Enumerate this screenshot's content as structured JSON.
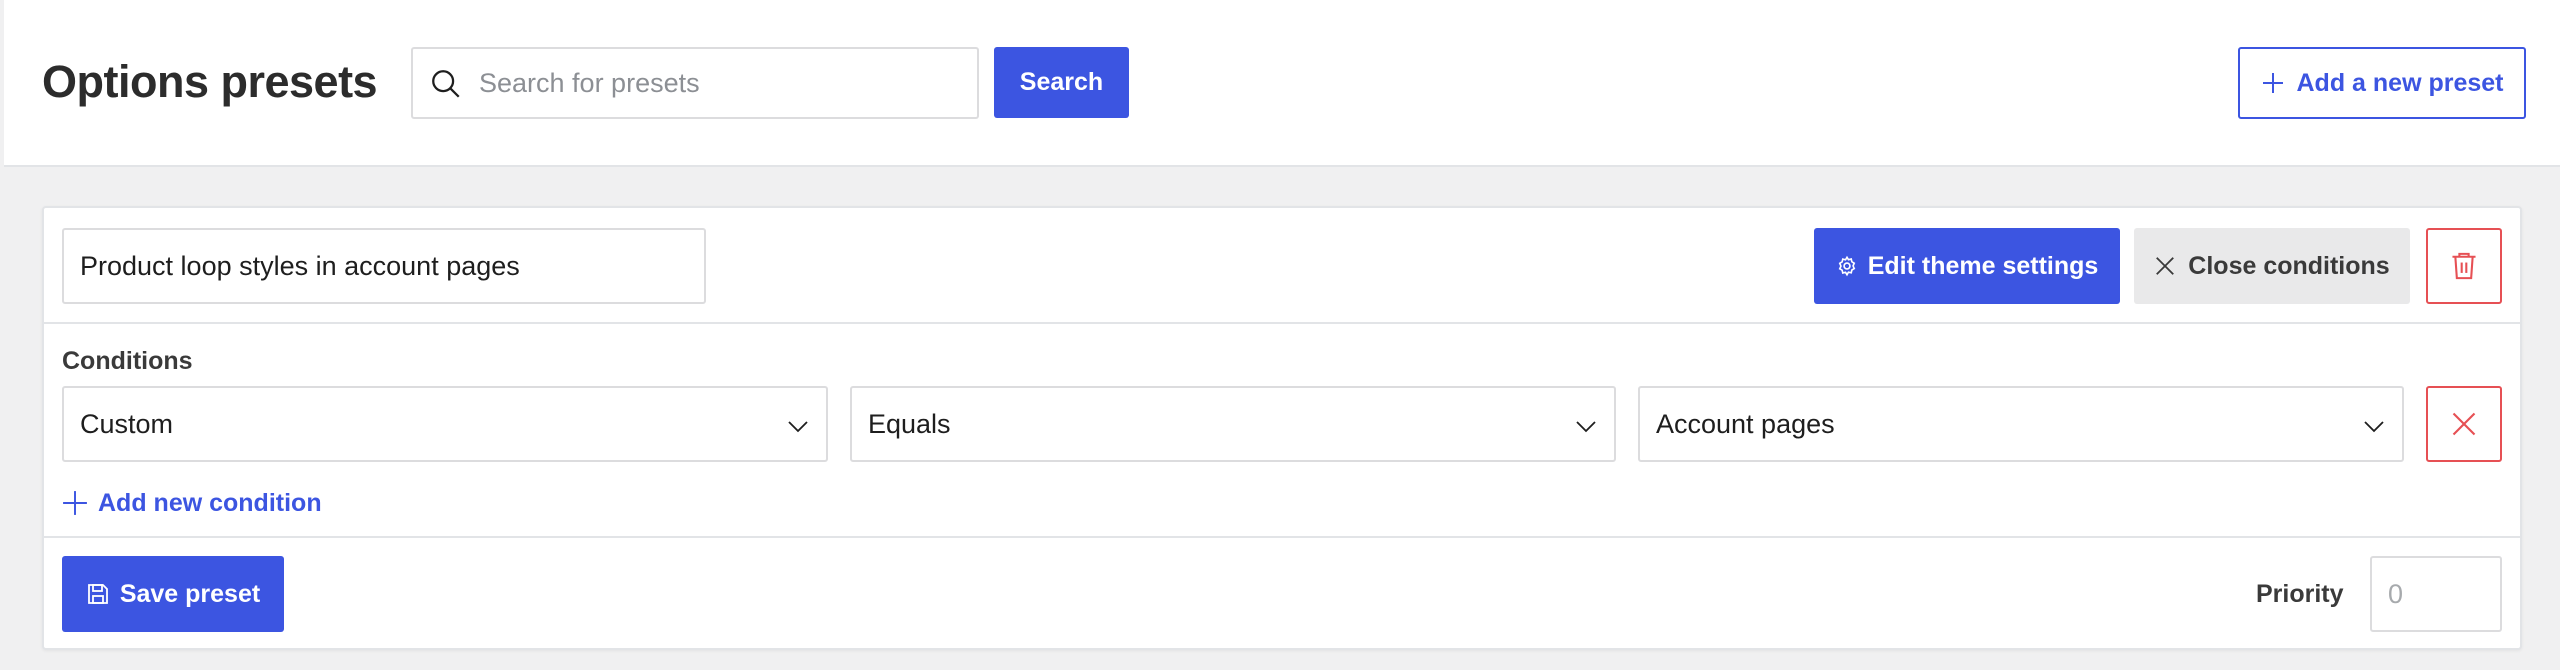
{
  "header": {
    "title": "Options presets",
    "search": {
      "placeholder": "Search for presets",
      "value": ""
    },
    "search_button": "Search",
    "add_preset_button": "Add a new preset"
  },
  "preset": {
    "name": "Product loop styles in account pages",
    "edit_theme_button": "Edit theme settings",
    "close_conditions_button": "Close conditions",
    "conditions_label": "Conditions",
    "conditions": [
      {
        "type": "Custom",
        "operator": "Equals",
        "value": "Account pages"
      }
    ],
    "add_condition_link": "Add new condition",
    "save_button": "Save preset",
    "priority_label": "Priority",
    "priority": {
      "placeholder": "0",
      "value": ""
    }
  },
  "icons": {
    "search": "search-icon",
    "plus": "plus-icon",
    "gear": "gear-icon",
    "close": "close-icon",
    "trash": "trash-icon",
    "chevron": "chevron-down-icon",
    "save": "save-icon"
  },
  "colors": {
    "accent": "#3c55e1",
    "danger": "#e65054",
    "neutral_button": "#e9e9ea"
  }
}
